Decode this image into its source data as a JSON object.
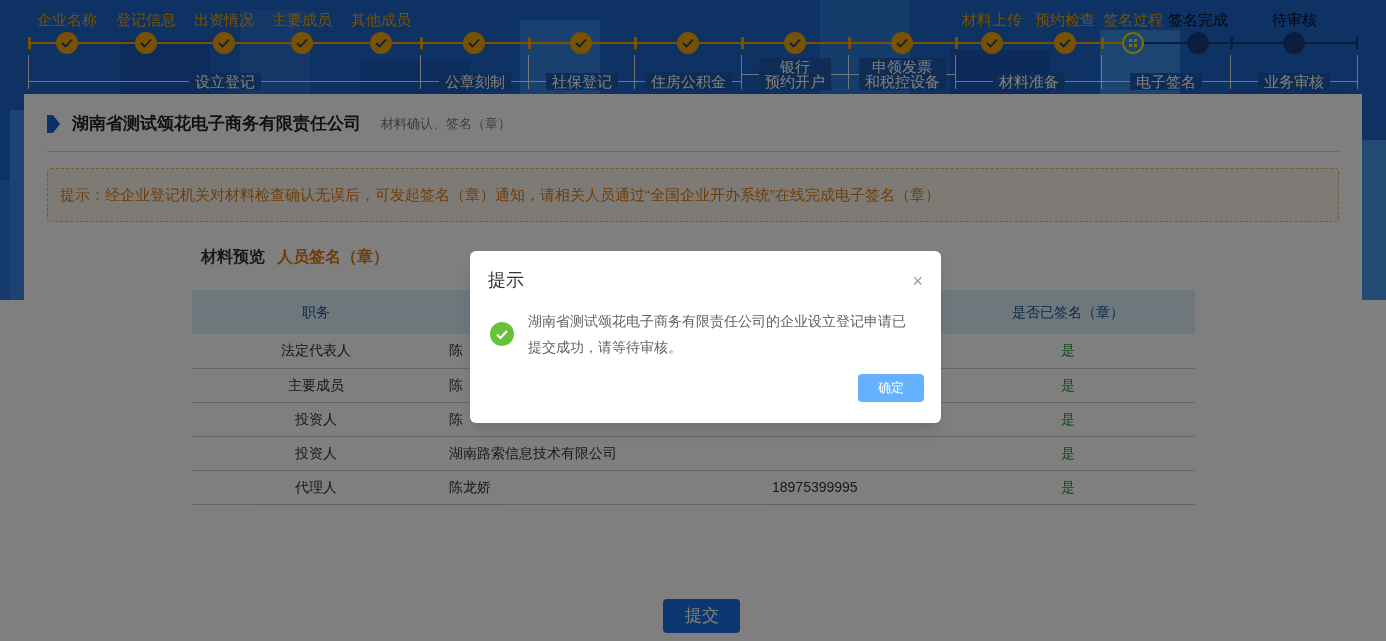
{
  "progress": {
    "groups": [
      {
        "label_lines": [
          "设立登记"
        ],
        "steps": [
          {
            "label": "企业名称",
            "completed": true,
            "current": false
          },
          {
            "label": "登记信息",
            "completed": true,
            "current": false
          },
          {
            "label": "出资情况",
            "completed": true,
            "current": false
          },
          {
            "label": "主要成员",
            "completed": true,
            "current": false
          },
          {
            "label": "其他成员",
            "completed": true,
            "current": false
          }
        ]
      },
      {
        "label_lines": [
          "公章刻制"
        ],
        "steps": [
          {
            "completed": true,
            "current": false
          }
        ]
      },
      {
        "label_lines": [
          "社保登记"
        ],
        "steps": [
          {
            "completed": true,
            "current": false
          }
        ]
      },
      {
        "label_lines": [
          "住房公积金"
        ],
        "steps": [
          {
            "completed": true,
            "current": false
          }
        ]
      },
      {
        "label_lines": [
          "银行",
          "预约开户"
        ],
        "steps": [
          {
            "completed": true,
            "current": false
          }
        ]
      },
      {
        "label_lines": [
          "申领发票",
          "和税控设备"
        ],
        "steps": [
          {
            "completed": true,
            "current": false
          }
        ]
      },
      {
        "label_lines": [
          "材料准备"
        ],
        "steps": [
          {
            "label": "材料上传",
            "completed": true,
            "current": false
          },
          {
            "label": "预约检查",
            "completed": true,
            "current": false
          }
        ]
      },
      {
        "label_lines": [
          "电子签名"
        ],
        "steps": [
          {
            "label": "签名过程",
            "completed": false,
            "current": true
          },
          {
            "label": "签名完成",
            "completed": false,
            "current": false
          }
        ]
      },
      {
        "label_lines": [
          "业务审核"
        ],
        "steps": [
          {
            "label": "待审核",
            "completed": false,
            "current": false
          }
        ]
      }
    ]
  },
  "card": {
    "title": "湖南省测试颂花电子商务有限责任公司",
    "subtitle": "材料确认、签名（章）",
    "notice": "提示：经企业登记机关对材料检查确认无误后，可发起签名（章）通知，请相关人员通过“全国企业开办系统”在线完成电子签名（章）",
    "tabs": [
      {
        "label": "材料预览",
        "selected": false
      },
      {
        "label": "人员签名（章）",
        "selected": true
      }
    ],
    "table": {
      "columns": [
        "职务",
        null,
        null,
        "是否已签名（章）"
      ],
      "rows": [
        [
          "法定代表人",
          "陈",
          "",
          "是"
        ],
        [
          "主要成员",
          "陈",
          "",
          "是"
        ],
        [
          "投资人",
          "陈",
          "",
          "是"
        ],
        [
          "投资人",
          "湖南路索信息技术有限公司",
          "",
          "是"
        ],
        [
          "代理人",
          "陈龙娇",
          "18975399995",
          "是"
        ]
      ]
    },
    "submit": "提交"
  },
  "dialog": {
    "title": "提示",
    "close": "×",
    "message": "湖南省测试颂花电子商务有限责任公司的企业设立登记申请已提交成功，请等待审核。",
    "ok": "确定"
  }
}
